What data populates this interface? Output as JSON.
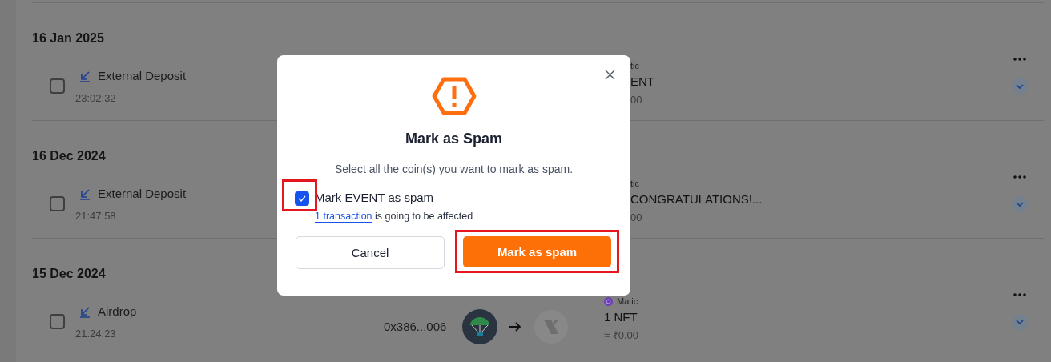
{
  "sections": [
    {
      "date": "16 Jan 2025",
      "rows": [
        {
          "checked": false,
          "type": "External Deposit",
          "time": "23:02:32",
          "coin": {
            "network": "tic",
            "name": "ENT",
            "value": "00"
          }
        }
      ]
    },
    {
      "date": "16 Dec 2024",
      "rows": [
        {
          "checked": false,
          "type": "External Deposit",
          "time": "21:47:58",
          "coin": {
            "network": "tic",
            "name": "CONGRATULATIONS!...",
            "value": "00"
          }
        }
      ]
    },
    {
      "date": "15 Dec 2024",
      "rows": [
        {
          "checked": false,
          "type": "Airdrop",
          "time": "21:24:23",
          "address": "0x386...006",
          "coin": {
            "network": "Matic",
            "name": "1 NFT",
            "value": "≈ ₹0.00"
          }
        }
      ]
    }
  ],
  "dialog": {
    "title": "Mark as Spam",
    "subtitle": "Select all the coin(s) you want to mark as spam.",
    "options": [
      {
        "label": "Mark EVENT as spam",
        "checked": true,
        "link": "1 transaction",
        "note": "is going to be affected"
      }
    ],
    "cancel": "Cancel",
    "confirm": "Mark as spam"
  }
}
